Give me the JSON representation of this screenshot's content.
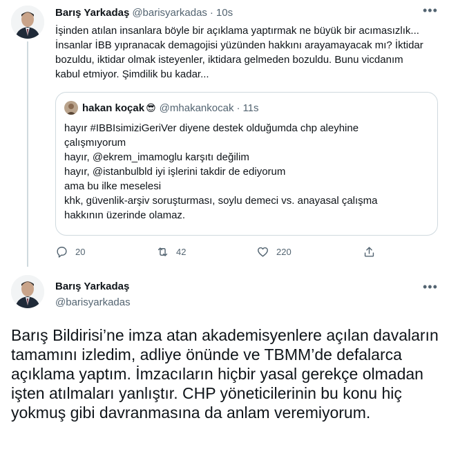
{
  "reply_tweet": {
    "display_name": "Barış Yarkadaş",
    "handle": "@barisyarkadas",
    "separator": "·",
    "time": "10s",
    "text": "İşinden atılan insanlara böyle bir açıklama yaptırmak ne büyük bir acımasızlık... İnsanlar İBB yıpranacak demagojisi yüzünden hakkını arayamayacak mı? İktidar bozuldu, iktidar olmak isteyenler, iktidara gelmeden bozuldu. Bunu vicdanım kabul etmiyor. Şimdilik bu kadar...",
    "quoted": {
      "display_name": "hakan koçak",
      "emoji": "😎",
      "handle": "@mhakankocak",
      "separator": "·",
      "time": "11s",
      "lines": [
        "hayır #IBBIsimiziGeriVer diyene destek olduğumda chp aleyhine çalışmıyorum",
        "hayır, @ekrem_imamoglu karşıtı değilim",
        "hayır, @istanbulbld iyi işlerini takdir de ediyorum",
        "ama bu ilke meselesi",
        "khk, güvenlik-arşiv soruşturması, soylu demeci vs. anayasal çalışma hakkının üzerinde olamaz."
      ]
    },
    "actions": {
      "reply_count": "20",
      "retweet_count": "42",
      "like_count": "220"
    }
  },
  "main_tweet": {
    "display_name": "Barış Yarkadaş",
    "handle": "@barisyarkadas",
    "text": "Barış Bildirisi’ne imza atan akademisyenlere açılan davaların tamamını izledim, adliye önünde ve  TBMM’de defalarca açıklama yaptım. İmzacıların hiçbir yasal gerekçe olmadan işten atılmaları yanlıştır. CHP yöneticilerinin bu konu hiç yokmuş gibi davranmasına da anlam veremiyorum."
  },
  "colors": {
    "text": "#0f1419",
    "muted": "#536471",
    "border": "#cfd9de"
  },
  "icons": [
    "more-icon",
    "reply-icon",
    "retweet-icon",
    "like-icon",
    "share-icon"
  ]
}
